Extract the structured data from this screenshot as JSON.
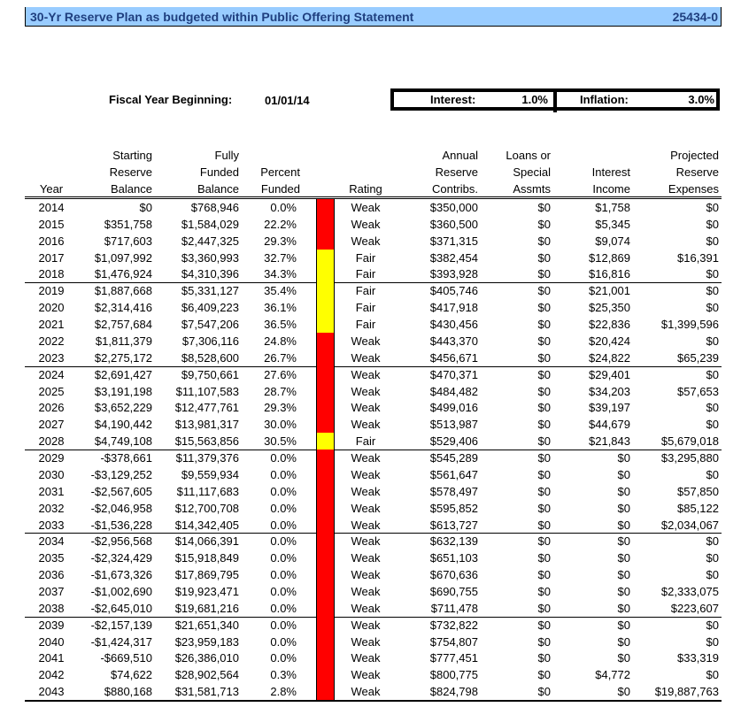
{
  "title": "30-Yr Reserve Plan as budgeted within Public Offering Statement",
  "code": "25434-0",
  "fiscal_label": "Fiscal Year Beginning:",
  "fiscal_value": "01/01/14",
  "interest_label": "Interest:",
  "interest_value": "1.0%",
  "inflation_label": "Inflation:",
  "inflation_value": "3.0%",
  "colors": {
    "weak": "#ff0000",
    "fair": "#ffff00",
    "title_bg": "#99ccff"
  },
  "headers": [
    [
      "",
      "",
      "Year"
    ],
    [
      "Starting",
      "Reserve",
      "Balance"
    ],
    [
      "Fully",
      "Funded",
      "Balance"
    ],
    [
      "",
      "Percent",
      "Funded"
    ],
    [
      "",
      "",
      "Rating"
    ],
    [
      "Annual",
      "Reserve",
      "Contribs."
    ],
    [
      "Loans or",
      "Special",
      "Assmts"
    ],
    [
      "",
      "Interest",
      "Income"
    ],
    [
      "Projected",
      "Reserve",
      "Expenses"
    ]
  ],
  "rows": [
    [
      "2014",
      "$0",
      "$768,946",
      "0.0%",
      "Weak",
      "$350,000",
      "$0",
      "$1,758",
      "$0"
    ],
    [
      "2015",
      "$351,758",
      "$1,584,029",
      "22.2%",
      "Weak",
      "$360,500",
      "$0",
      "$5,345",
      "$0"
    ],
    [
      "2016",
      "$717,603",
      "$2,447,325",
      "29.3%",
      "Weak",
      "$371,315",
      "$0",
      "$9,074",
      "$0"
    ],
    [
      "2017",
      "$1,097,992",
      "$3,360,993",
      "32.7%",
      "Fair",
      "$382,454",
      "$0",
      "$12,869",
      "$16,391"
    ],
    [
      "2018",
      "$1,476,924",
      "$4,310,396",
      "34.3%",
      "Fair",
      "$393,928",
      "$0",
      "$16,816",
      "$0"
    ],
    [
      "2019",
      "$1,887,668",
      "$5,331,127",
      "35.4%",
      "Fair",
      "$405,746",
      "$0",
      "$21,001",
      "$0"
    ],
    [
      "2020",
      "$2,314,416",
      "$6,409,223",
      "36.1%",
      "Fair",
      "$417,918",
      "$0",
      "$25,350",
      "$0"
    ],
    [
      "2021",
      "$2,757,684",
      "$7,547,206",
      "36.5%",
      "Fair",
      "$430,456",
      "$0",
      "$22,836",
      "$1,399,596"
    ],
    [
      "2022",
      "$1,811,379",
      "$7,306,116",
      "24.8%",
      "Weak",
      "$443,370",
      "$0",
      "$20,424",
      "$0"
    ],
    [
      "2023",
      "$2,275,172",
      "$8,528,600",
      "26.7%",
      "Weak",
      "$456,671",
      "$0",
      "$24,822",
      "$65,239"
    ],
    [
      "2024",
      "$2,691,427",
      "$9,750,661",
      "27.6%",
      "Weak",
      "$470,371",
      "$0",
      "$29,401",
      "$0"
    ],
    [
      "2025",
      "$3,191,198",
      "$11,107,583",
      "28.7%",
      "Weak",
      "$484,482",
      "$0",
      "$34,203",
      "$57,653"
    ],
    [
      "2026",
      "$3,652,229",
      "$12,477,761",
      "29.3%",
      "Weak",
      "$499,016",
      "$0",
      "$39,197",
      "$0"
    ],
    [
      "2027",
      "$4,190,442",
      "$13,981,317",
      "30.0%",
      "Weak",
      "$513,987",
      "$0",
      "$44,679",
      "$0"
    ],
    [
      "2028",
      "$4,749,108",
      "$15,563,856",
      "30.5%",
      "Fair",
      "$529,406",
      "$0",
      "$21,843",
      "$5,679,018"
    ],
    [
      "2029",
      "-$378,661",
      "$11,379,376",
      "0.0%",
      "Weak",
      "$545,289",
      "$0",
      "$0",
      "$3,295,880"
    ],
    [
      "2030",
      "-$3,129,252",
      "$9,559,934",
      "0.0%",
      "Weak",
      "$561,647",
      "$0",
      "$0",
      "$0"
    ],
    [
      "2031",
      "-$2,567,605",
      "$11,117,683",
      "0.0%",
      "Weak",
      "$578,497",
      "$0",
      "$0",
      "$57,850"
    ],
    [
      "2032",
      "-$2,046,958",
      "$12,700,708",
      "0.0%",
      "Weak",
      "$595,852",
      "$0",
      "$0",
      "$85,122"
    ],
    [
      "2033",
      "-$1,536,228",
      "$14,342,405",
      "0.0%",
      "Weak",
      "$613,727",
      "$0",
      "$0",
      "$2,034,067"
    ],
    [
      "2034",
      "-$2,956,568",
      "$14,066,391",
      "0.0%",
      "Weak",
      "$632,139",
      "$0",
      "$0",
      "$0"
    ],
    [
      "2035",
      "-$2,324,429",
      "$15,918,849",
      "0.0%",
      "Weak",
      "$651,103",
      "$0",
      "$0",
      "$0"
    ],
    [
      "2036",
      "-$1,673,326",
      "$17,869,795",
      "0.0%",
      "Weak",
      "$670,636",
      "$0",
      "$0",
      "$0"
    ],
    [
      "2037",
      "-$1,002,690",
      "$19,923,471",
      "0.0%",
      "Weak",
      "$690,755",
      "$0",
      "$0",
      "$2,333,075"
    ],
    [
      "2038",
      "-$2,645,010",
      "$19,681,216",
      "0.0%",
      "Weak",
      "$711,478",
      "$0",
      "$0",
      "$223,607"
    ],
    [
      "2039",
      "-$2,157,139",
      "$21,651,340",
      "0.0%",
      "Weak",
      "$732,822",
      "$0",
      "$0",
      "$0"
    ],
    [
      "2040",
      "-$1,424,317",
      "$23,959,183",
      "0.0%",
      "Weak",
      "$754,807",
      "$0",
      "$0",
      "$0"
    ],
    [
      "2041",
      "-$669,510",
      "$26,386,010",
      "0.0%",
      "Weak",
      "$777,451",
      "$0",
      "$0",
      "$33,319"
    ],
    [
      "2042",
      "$74,622",
      "$28,902,564",
      "0.3%",
      "Weak",
      "$800,775",
      "$0",
      "$4,772",
      "$0"
    ],
    [
      "2043",
      "$880,168",
      "$31,581,713",
      "2.8%",
      "Weak",
      "$824,798",
      "$0",
      "$0",
      "$19,887,763"
    ]
  ]
}
